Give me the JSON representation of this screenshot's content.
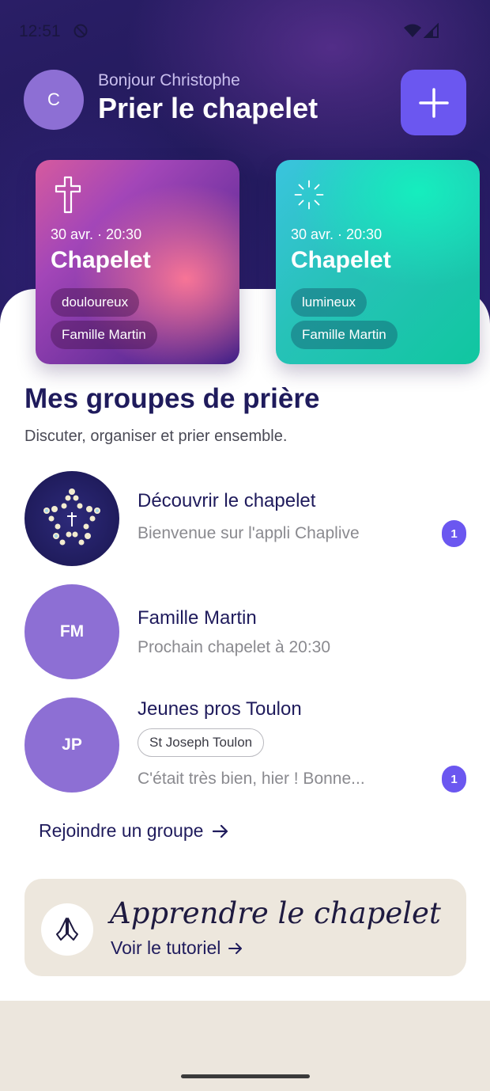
{
  "status_bar": {
    "time": "12:51"
  },
  "header": {
    "avatar_initial": "C",
    "greeting": "Bonjour Christophe",
    "title": "Prier le chapelet"
  },
  "cards": [
    {
      "date": "30 avr. · 20:30",
      "title": "Chapelet",
      "type": "douloureux",
      "group": "Famille Martin",
      "icon": "cross-icon"
    },
    {
      "date": "30 avr. · 20:30",
      "title": "Chapelet",
      "type": "lumineux",
      "group": "Famille Martin",
      "icon": "light-rays-icon"
    }
  ],
  "groups_section": {
    "title": "Mes groupes de prière",
    "subtitle": "Discuter, organiser et prier ensemble."
  },
  "groups": [
    {
      "name": "Découvrir le chapelet",
      "message": "Bienvenue sur l'appli Chaplive",
      "badge": "1",
      "avatar": "rosary-star-image"
    },
    {
      "name": "Famille Martin",
      "initials": "FM",
      "message": "Prochain chapelet à 20:30"
    },
    {
      "name": "Jeunes pros Toulon",
      "initials": "JP",
      "parish": "St Joseph Toulon",
      "message": "C'était très bien, hier ! Bonne...",
      "badge": "1"
    }
  ],
  "join_link": "Rejoindre un groupe",
  "tutorial": {
    "title": "Apprendre le chapelet",
    "link": "Voir le tutoriel",
    "icon": "praying-hands-icon"
  },
  "colors": {
    "accent": "#6b57f0",
    "avatar": "#8d6fd4",
    "heading": "#1f1b5c",
    "hero_bg": "#261c66"
  }
}
